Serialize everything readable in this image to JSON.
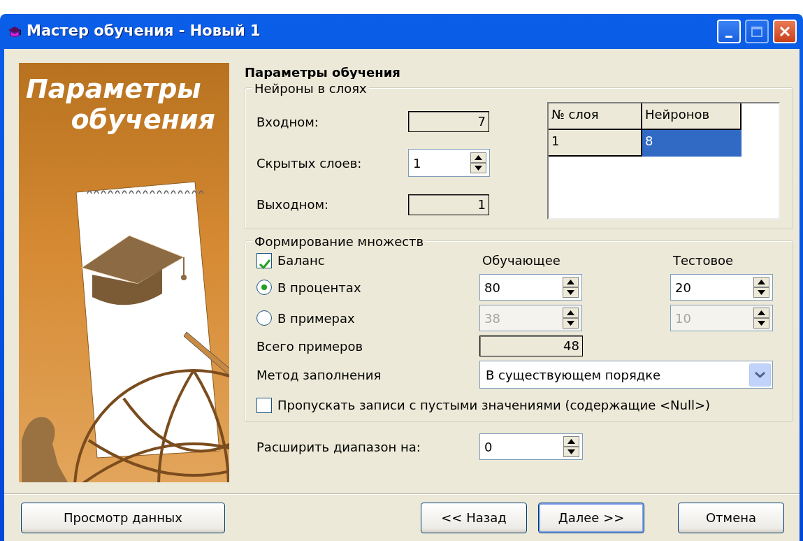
{
  "window": {
    "title": "Мастер обучения - Новый 1",
    "maximize_disabled": true
  },
  "banner": {
    "title_lines": [
      "Параметры",
      "обучения"
    ]
  },
  "page_title": "Параметры обучения",
  "neurons_group": {
    "legend": "Нейроны в слоях",
    "fields": [
      {
        "label": "Входном:",
        "value": "7",
        "kind": "readonly"
      },
      {
        "label": "Скрытых слоев:",
        "value": "1",
        "kind": "spin"
      },
      {
        "label": "Выходном:",
        "value": "1",
        "kind": "readonly"
      }
    ],
    "layer_table": {
      "columns": [
        "№ слоя",
        "Нейронов"
      ],
      "rows": [
        {
          "cells": [
            "1",
            "8"
          ],
          "selected": true
        }
      ]
    }
  },
  "sets_group": {
    "legend": "Формирование множеств",
    "balance": {
      "label": "Баланс",
      "checked": true
    },
    "columns": [
      "Обучающее",
      "Тестовое"
    ],
    "modes": [
      {
        "label": "В процентах",
        "selected": true,
        "values": [
          {
            "value": "80",
            "disabled": false
          },
          {
            "value": "20",
            "disabled": false
          }
        ]
      },
      {
        "label": "В примерах",
        "selected": false,
        "values": [
          {
            "value": "38",
            "disabled": true
          },
          {
            "value": "10",
            "disabled": true
          }
        ]
      }
    ],
    "total": {
      "label": "Всего примеров",
      "value": "48"
    },
    "fill_method": {
      "label": "Метод заполнения",
      "value": "В существующем порядке"
    },
    "skip_nulls": {
      "label": "Пропускать записи с пустыми значениями (содержащие <Null>)",
      "checked": false
    }
  },
  "expand": {
    "label": "Расширить диапазон на:",
    "value": "0"
  },
  "buttons": [
    {
      "label": "Просмотр данных",
      "default": false,
      "kind": "left"
    },
    {
      "label": "<< Назад",
      "default": false,
      "kind": "right"
    },
    {
      "label": "Далее >>",
      "default": true,
      "kind": "right"
    },
    {
      "label": "Отмена",
      "default": false,
      "kind": "cancel"
    }
  ]
}
